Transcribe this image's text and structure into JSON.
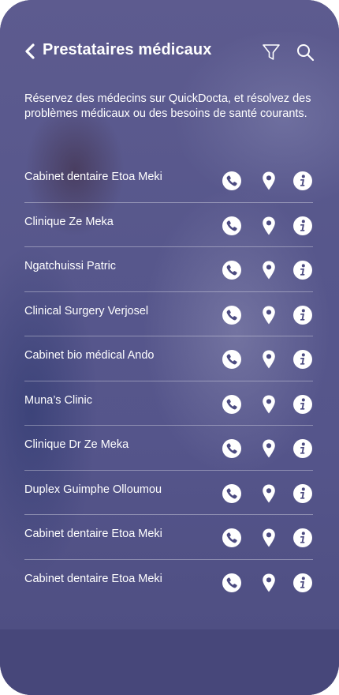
{
  "header": {
    "title": "Prestataires médicaux",
    "back_icon": "chevron-left-icon",
    "filter_icon": "filter-icon",
    "search_icon": "search-icon"
  },
  "intro": "Réservez des médecins sur QuickDocta, et résolvez des problèmes médicaux ou des besoins de santé courants.",
  "providers": [
    {
      "name": "Cabinet dentaire Etoa Meki"
    },
    {
      "name": "Clinique Ze Meka"
    },
    {
      "name": "Ngatchuissi Patric"
    },
    {
      "name": "Clinical Surgery Verjosel"
    },
    {
      "name": "Cabinet bio médical Ando"
    },
    {
      "name": "Muna’s Clinic"
    },
    {
      "name": "Clinique Dr Ze Meka"
    },
    {
      "name": "Duplex Guimphe Olloumou"
    },
    {
      "name": "Cabinet dentaire Etoa Meki"
    },
    {
      "name": "Cabinet dentaire Etoa Meki"
    }
  ],
  "row_actions": [
    "phone-icon",
    "location-pin-icon",
    "info-icon"
  ],
  "colors": {
    "background": "#5a598c",
    "bottom_band": "#47477a",
    "text": "#ffffff"
  }
}
